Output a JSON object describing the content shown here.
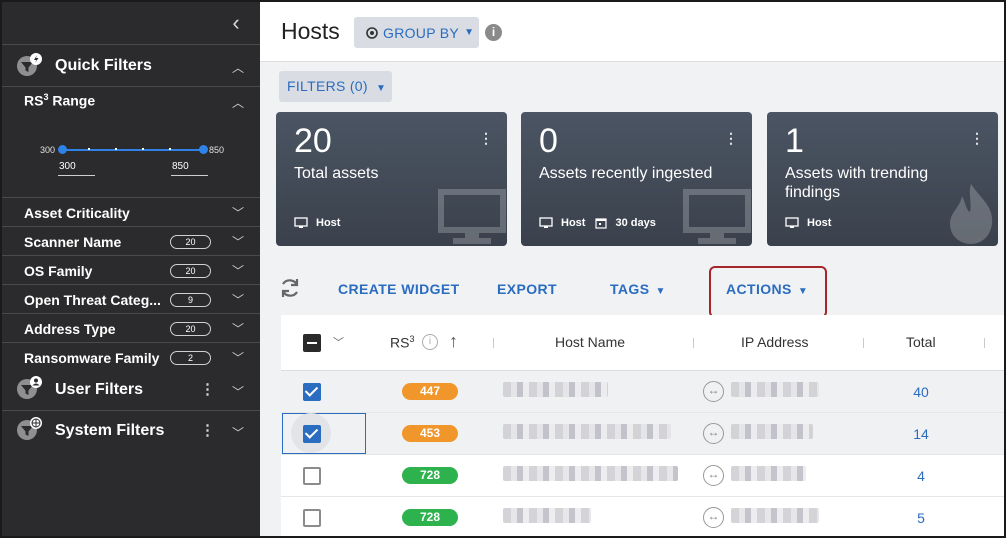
{
  "sidebar": {
    "quick_filters": "Quick Filters",
    "rs_range": {
      "label": "RS",
      "sup": "3",
      "suffix": " Range",
      "min_tick": "300",
      "max_tick": "850",
      "min_value": "300",
      "max_value": "850"
    },
    "filters": [
      {
        "name": "Asset Criticality",
        "count": ""
      },
      {
        "name": "Scanner Name",
        "count": "20"
      },
      {
        "name": "OS Family",
        "count": "20"
      },
      {
        "name": "Open Threat Categ...",
        "count": "9"
      },
      {
        "name": "Address Type",
        "count": "20"
      },
      {
        "name": "Ransomware Family",
        "count": "2"
      }
    ],
    "user_filters": "User Filters",
    "system_filters": "System Filters"
  },
  "header": {
    "title": "Hosts",
    "group_by": "GROUP BY"
  },
  "filters_button": "FILTERS (0)",
  "cards": [
    {
      "number": "20",
      "label": "Total assets",
      "tags": [
        "Host"
      ]
    },
    {
      "number": "0",
      "label": "Assets recently ingested",
      "tags": [
        "Host",
        "30 days"
      ]
    },
    {
      "number": "1",
      "label": "Assets with trending findings",
      "tags": [
        "Host"
      ]
    }
  ],
  "toolbar": {
    "create_widget": "CREATE WIDGET",
    "export": "EXPORT",
    "tags": "TAGS",
    "actions": "ACTIONS"
  },
  "table": {
    "columns": {
      "rs": "RS",
      "rs_sup": "3",
      "host_name": "Host Name",
      "ip_address": "IP Address",
      "total": "Total"
    },
    "rows": [
      {
        "checked": true,
        "rs": "447",
        "rs_color": "#f0962a",
        "total": "40"
      },
      {
        "checked": true,
        "rs": "453",
        "rs_color": "#f0962a",
        "total": "14"
      },
      {
        "checked": false,
        "rs": "728",
        "rs_color": "#2db24d",
        "total": "4"
      },
      {
        "checked": false,
        "rs": "728",
        "rs_color": "#2db24d",
        "total": "5"
      }
    ]
  },
  "colors": {
    "accent": "#2a6cc0",
    "sidebar_bg": "#2b2b2d",
    "highlight_border": "#a6262b"
  }
}
